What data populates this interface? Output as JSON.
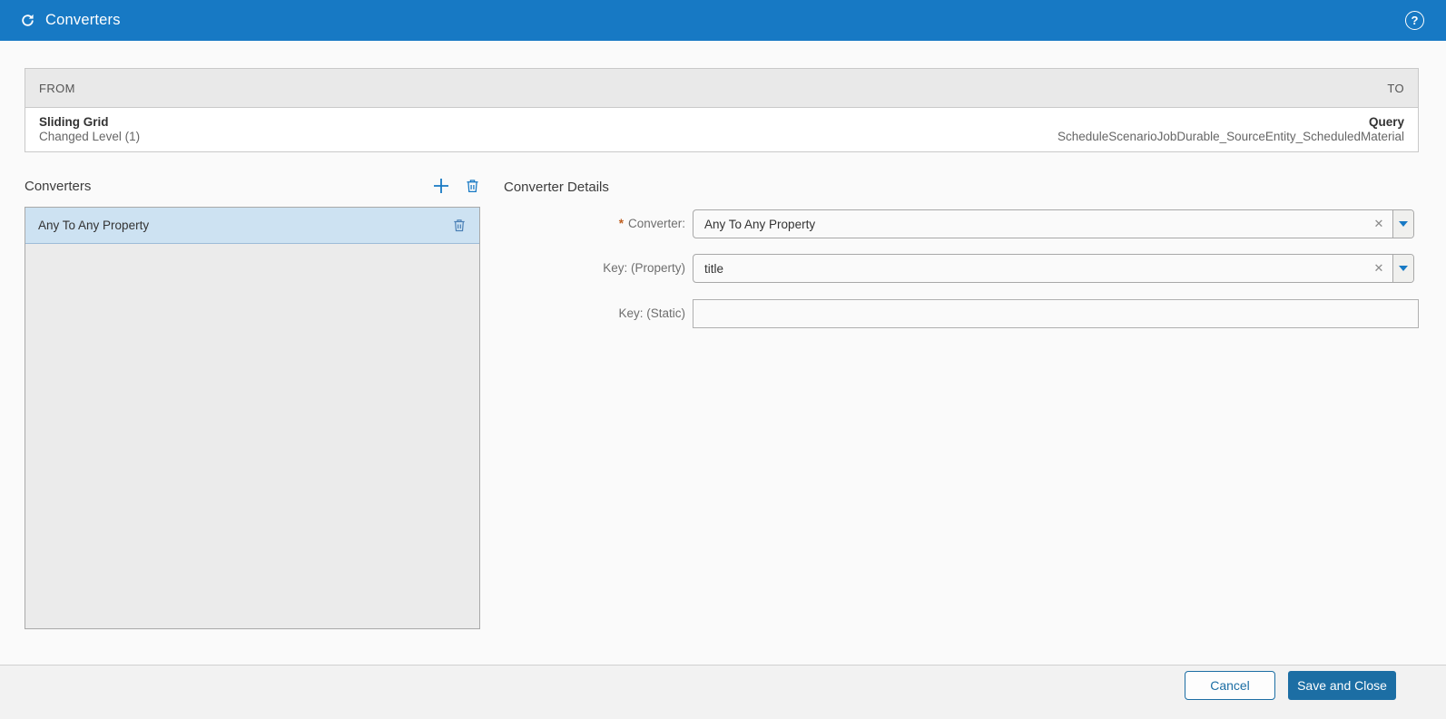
{
  "header": {
    "title": "Converters",
    "help_char": "?"
  },
  "mapping_table": {
    "from_header": "FROM",
    "to_header": "TO",
    "row": {
      "from_primary": "Sliding Grid",
      "from_secondary": "Changed Level (1)",
      "to_primary": "Query",
      "to_secondary": "ScheduleScenarioJobDurable_SourceEntity_ScheduledMaterial"
    }
  },
  "converters_panel": {
    "title": "Converters",
    "items": [
      {
        "label": "Any To Any Property",
        "selected": true
      }
    ]
  },
  "details_panel": {
    "title": "Converter Details",
    "required_marker": "*",
    "clear_char": "✕",
    "fields": [
      {
        "label": "Converter:",
        "required": true,
        "value": "Any To Any Property",
        "type": "combo"
      },
      {
        "label": "Key: (Property)",
        "required": false,
        "value": "title",
        "type": "combo"
      },
      {
        "label": "Key: (Static)",
        "required": false,
        "value": "",
        "type": "text"
      }
    ]
  },
  "footer": {
    "cancel_label": "Cancel",
    "save_label": "Save and Close"
  },
  "colors": {
    "header_blue": "#1779c4",
    "button_blue": "#1c6ea4",
    "selected_item_bg": "#cde2f2",
    "list_bg": "#ebebeb",
    "table_header_bg": "#e9e9e9",
    "required_marker": "#bf5e1f"
  }
}
